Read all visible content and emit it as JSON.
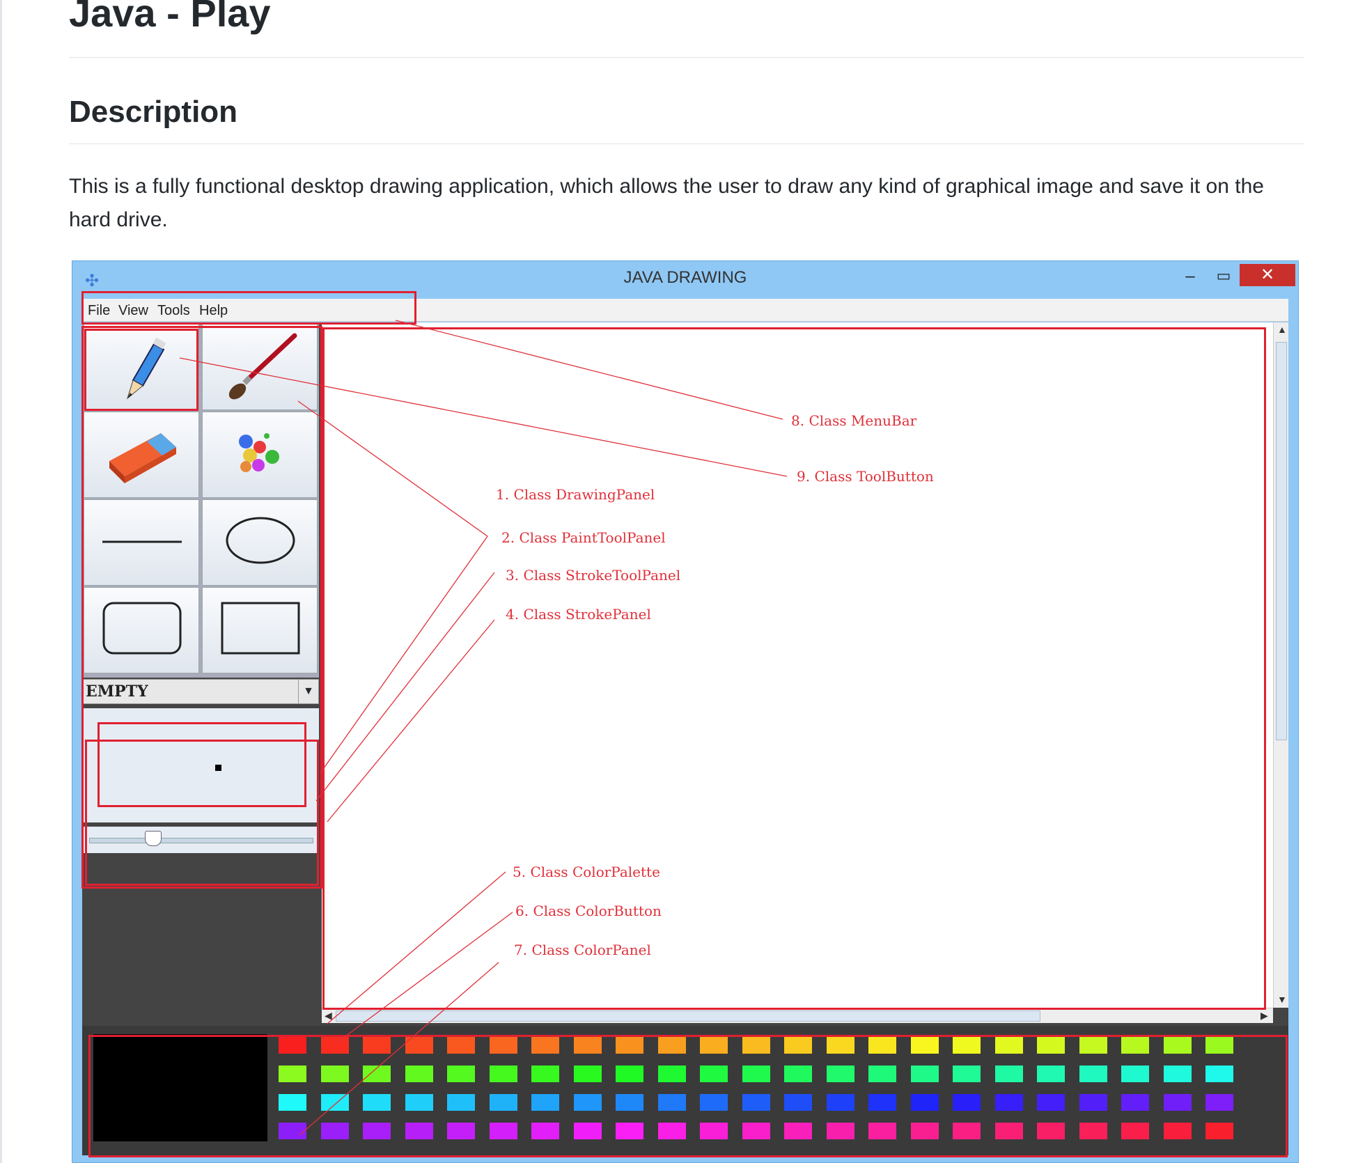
{
  "page": {
    "title": "Java - Play",
    "section_title": "Description",
    "description": "This is a fully functional desktop drawing application, which allows the user to draw any kind of graphical image and save it on the hard drive."
  },
  "app": {
    "window_title": "JAVA DRAWING",
    "close_symbol": "✕",
    "minimize_symbol": "–",
    "maximize_symbol": "▭",
    "menu": [
      "File",
      "View",
      "Tools",
      "Help"
    ],
    "tools": [
      "pencil",
      "brush",
      "eraser",
      "color-dots",
      "line",
      "ellipse",
      "rounded-rectangle",
      "rectangle"
    ],
    "stroke_type": "EMPTY",
    "palette_rows": 4,
    "palette_cols": 23,
    "current_color": "#000000",
    "accent_annotation_color": "#e0303a"
  },
  "annotations": {
    "a1": "1. Class DrawingPanel",
    "a2": "2. Class PaintToolPanel",
    "a3": "3. Class StrokeToolPanel",
    "a4": "4. Class StrokePanel",
    "a5": "5. Class ColorPalette",
    "a6": "6. Class ColorButton",
    "a7": "7. Class ColorPanel",
    "a8": "8. Class MenuBar",
    "a9": "9. Class ToolButton"
  }
}
